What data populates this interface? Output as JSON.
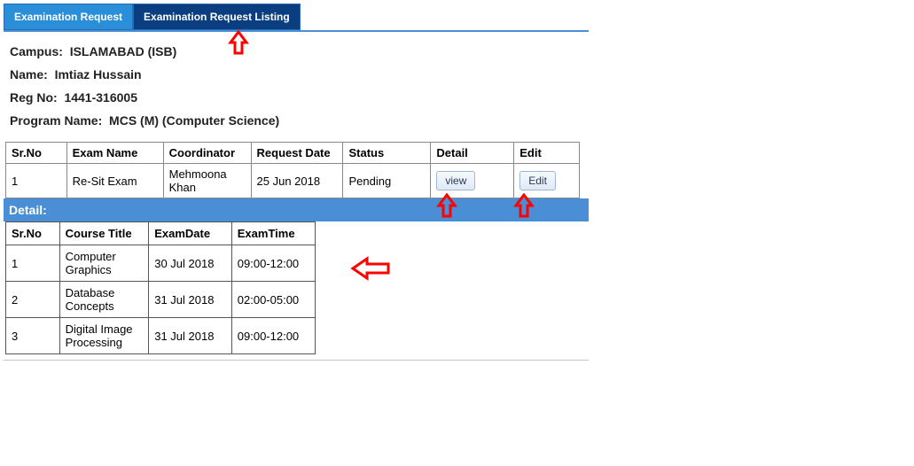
{
  "tabs": {
    "request": "Examination Request",
    "listing": "Examination Request Listing"
  },
  "info": {
    "campus_label": "Campus:",
    "campus_value": "ISLAMABAD (ISB)",
    "name_label": "Name:",
    "name_value": "Imtiaz Hussain",
    "reg_label": "Reg No:",
    "reg_value": "1441-316005",
    "program_label": "Program Name:",
    "program_value": "MCS (M) (Computer Science)"
  },
  "req_headers": {
    "sr": "Sr.No",
    "exam": "Exam Name",
    "coord": "Coordinator",
    "date": "Request Date",
    "status": "Status",
    "detail": "Detail",
    "edit": "Edit"
  },
  "req_rows": [
    {
      "sr": "1",
      "exam": "Re-Sit Exam",
      "coord": "Mehmoona Khan",
      "date": "25 Jun 2018",
      "status": "Pending",
      "view_btn": "view",
      "edit_btn": "Edit"
    }
  ],
  "detail_bar": "Detail:",
  "detail_headers": {
    "sr": "Sr.No",
    "course": "Course Title",
    "edate": "ExamDate",
    "etime": "ExamTime"
  },
  "detail_rows": [
    {
      "sr": "1",
      "course": "Computer Graphics",
      "edate": "30 Jul 2018",
      "etime": "09:00-12:00"
    },
    {
      "sr": "2",
      "course": "Database Concepts",
      "edate": "31 Jul 2018",
      "etime": "02:00-05:00"
    },
    {
      "sr": "3",
      "course": "Digital Image Processing",
      "edate": "31 Jul 2018",
      "etime": "09:00-12:00"
    }
  ]
}
